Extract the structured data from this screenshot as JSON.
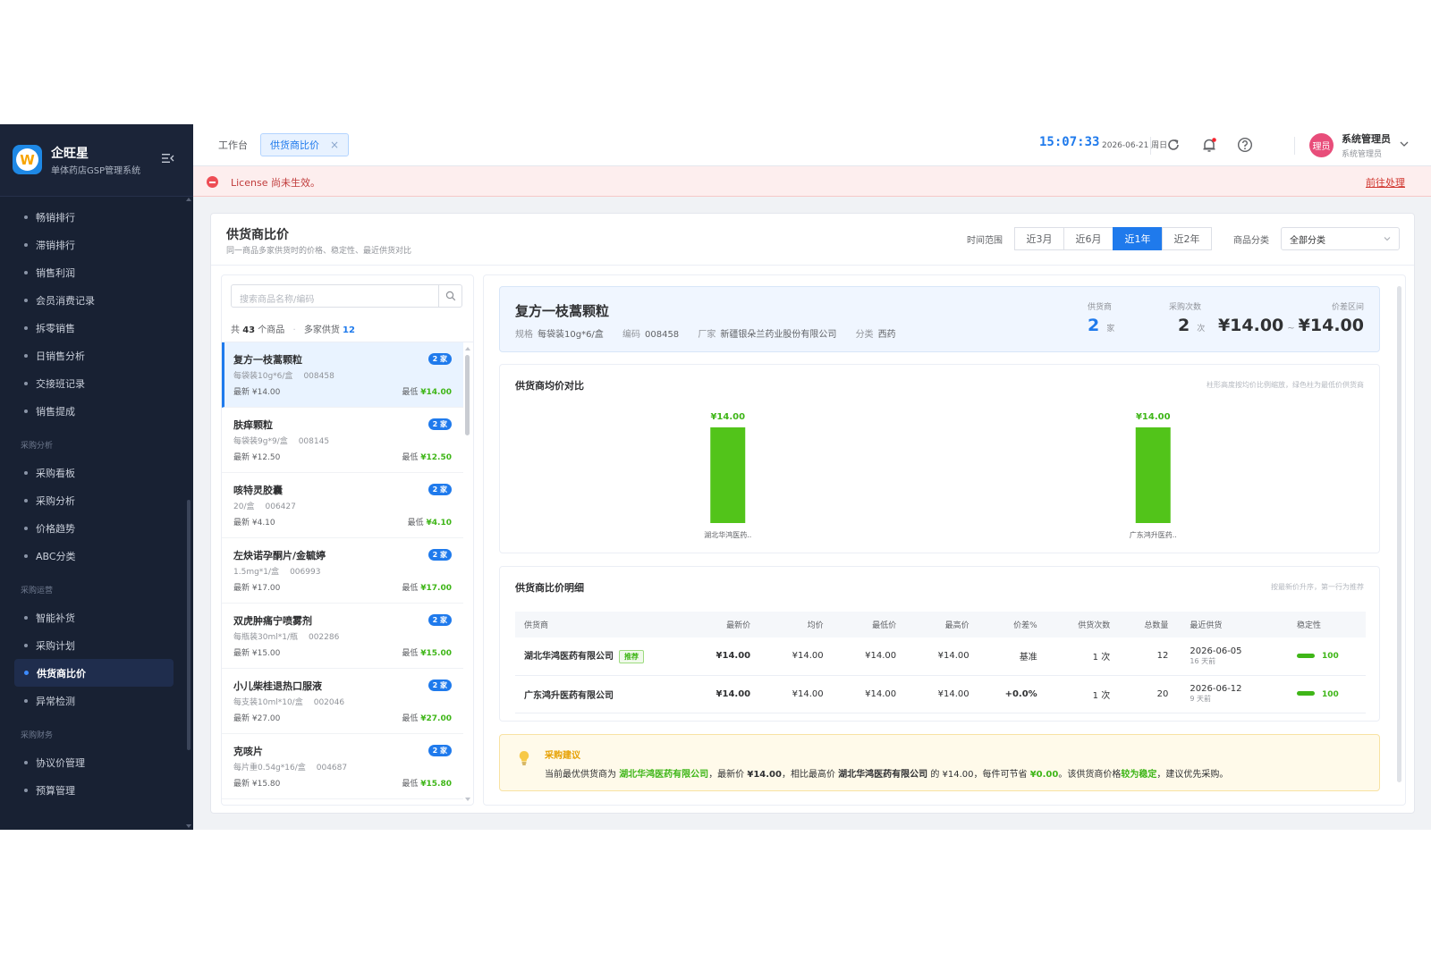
{
  "brand": {
    "title": "企旺星",
    "subtitle": "单体药店GSP管理系统",
    "logo_letter": "W"
  },
  "sidebar": {
    "items": [
      {
        "label": "畅销排行",
        "type": "item"
      },
      {
        "label": "滞销排行",
        "type": "item"
      },
      {
        "label": "销售利润",
        "type": "item"
      },
      {
        "label": "会员消费记录",
        "type": "item"
      },
      {
        "label": "拆零销售",
        "type": "item"
      },
      {
        "label": "日销售分析",
        "type": "item"
      },
      {
        "label": "交接班记录",
        "type": "item"
      },
      {
        "label": "销售提成",
        "type": "item"
      },
      {
        "label": "采购分析",
        "type": "group"
      },
      {
        "label": "采购看板",
        "type": "item"
      },
      {
        "label": "采购分析",
        "type": "item"
      },
      {
        "label": "价格趋势",
        "type": "item"
      },
      {
        "label": "ABC分类",
        "type": "item"
      },
      {
        "label": "采购运营",
        "type": "group"
      },
      {
        "label": "智能补货",
        "type": "item"
      },
      {
        "label": "采购计划",
        "type": "item"
      },
      {
        "label": "供货商比价",
        "type": "item",
        "active": true
      },
      {
        "label": "异常检测",
        "type": "item"
      },
      {
        "label": "采购财务",
        "type": "group"
      },
      {
        "label": "协议价管理",
        "type": "item"
      },
      {
        "label": "预算管理",
        "type": "item"
      }
    ]
  },
  "header": {
    "home_tab": "工作台",
    "active_tab": "供货商比价",
    "close_glyph": "×",
    "clock": "15:07:33",
    "date": "2026-06-21 周日",
    "avatar_text": "理员",
    "user_name": "系统管理员",
    "user_role": "系统管理员"
  },
  "license": {
    "message": "License 尚未生效。",
    "action": "前往处理"
  },
  "page": {
    "title": "供货商比价",
    "description": "同一商品多家供货时的价格、稳定性、最近供货对比",
    "range_label": "时间范围",
    "ranges": [
      "近3月",
      "近6月",
      "近1年",
      "近2年"
    ],
    "active_range": 2,
    "category_label": "商品分类",
    "category_value": "全部分类"
  },
  "product_list": {
    "search_placeholder": "搜索商品名称/编码",
    "count_prefix": "共",
    "count": "43",
    "count_suffix": "个商品",
    "multi_label": "多家供货",
    "multi_count": "12",
    "items": [
      {
        "name": "复方一枝蒿颗粒",
        "badge": "2 家",
        "spec": "每袋装10g*6/盒",
        "code": "008458",
        "latest": "最新 ¥14.00",
        "low_label": "最低",
        "low": "¥14.00",
        "active": true
      },
      {
        "name": "肤痒颗粒",
        "badge": "2 家",
        "spec": "每袋装9g*9/盒",
        "code": "008145",
        "latest": "最新 ¥12.50",
        "low_label": "最低",
        "low": "¥12.50"
      },
      {
        "name": "咳特灵胶囊",
        "badge": "2 家",
        "spec": "20/盒",
        "code": "006427",
        "latest": "最新 ¥4.10",
        "low_label": "最低",
        "low": "¥4.10"
      },
      {
        "name": "左炔诺孕酮片/金毓婷",
        "badge": "2 家",
        "spec": "1.5mg*1/盒",
        "code": "006993",
        "latest": "最新 ¥17.00",
        "low_label": "最低",
        "low": "¥17.00"
      },
      {
        "name": "双虎肿痛宁喷雾剂",
        "badge": "2 家",
        "spec": "每瓶装30ml*1/瓶",
        "code": "002286",
        "latest": "最新 ¥15.00",
        "low_label": "最低",
        "low": "¥15.00"
      },
      {
        "name": "小儿柴桂退热口服液",
        "badge": "2 家",
        "spec": "每支装10ml*10/盒",
        "code": "002046",
        "latest": "最新 ¥27.00",
        "low_label": "最低",
        "low": "¥27.00"
      },
      {
        "name": "克咳片",
        "badge": "2 家",
        "spec": "每片重0.54g*16/盒",
        "code": "004687",
        "latest": "最新 ¥15.80",
        "low_label": "最低",
        "low": "¥15.80"
      }
    ]
  },
  "summary": {
    "name": "复方一枝蒿颗粒",
    "spec_label": "规格",
    "spec": "每袋装10g*6/盒",
    "code_label": "编码",
    "code": "008458",
    "maker_label": "厂家",
    "maker": "新疆银朵兰药业股份有限公司",
    "category_label": "分类",
    "category": "西药",
    "suppliers_label": "供货商",
    "suppliers": "2",
    "suppliers_unit": "家",
    "purchases_label": "采购次数",
    "purchases": "2",
    "purchases_unit": "次",
    "range_label": "价差区间",
    "price_min": "¥14.00",
    "price_sep": "~",
    "price_max": "¥14.00"
  },
  "chart": {
    "title": "供货商均价对比",
    "note": "柱形高度按均价比例缩放，绿色柱为最低价供货商",
    "bar_color": "#52c41a"
  },
  "chart_data": {
    "type": "bar",
    "categories": [
      "湖北华鸿医药..",
      "广东鸿升医药.."
    ],
    "values": [
      14.0,
      14.0
    ],
    "value_labels": [
      "¥14.00",
      "¥14.00"
    ],
    "title": "供货商均价对比",
    "xlabel": "",
    "ylabel": "",
    "ylim": [
      0,
      14.0
    ],
    "grid": false
  },
  "table": {
    "title": "供货商比价明细",
    "note": "按最新价升序，第一行为推荐",
    "columns": [
      "供货商",
      "最新价",
      "均价",
      "最低价",
      "最高价",
      "价差%",
      "供货次数",
      "总数量",
      "最近供货",
      "稳定性"
    ],
    "rows": [
      {
        "supplier": "湖北华鸿医药有限公司",
        "tag": "推荐",
        "latest": "¥14.00",
        "avg": "¥14.00",
        "low": "¥14.00",
        "high": "¥14.00",
        "diff": "基准",
        "times": "1 次",
        "qty": "12",
        "last_date": "2026-06-05",
        "last_ago": "16 天前",
        "stability": "100"
      },
      {
        "supplier": "广东鸿升医药有限公司",
        "tag": "",
        "latest": "¥14.00",
        "avg": "¥14.00",
        "low": "¥14.00",
        "high": "¥14.00",
        "diff": "+0.0%",
        "times": "1 次",
        "qty": "20",
        "last_date": "2026-06-12",
        "last_ago": "9 天前",
        "stability": "100"
      }
    ]
  },
  "advice": {
    "title": "采购建议",
    "t1": "当前最优供货商为 ",
    "best": "湖北华鸿医药有限公司",
    "t2": "，最新价 ",
    "price": "¥14.00",
    "t3": "，相比最高价 ",
    "high_supplier": "湖北华鸿医药有限公司",
    "t4": " 的 ¥14.00，每件可节省 ",
    "save": "¥0.00",
    "t5": "。该供货商价格",
    "stable": "较为稳定",
    "t6": "，建议优先采购。"
  }
}
